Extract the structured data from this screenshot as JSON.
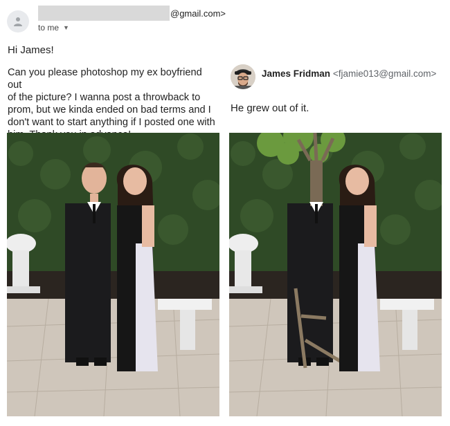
{
  "original_email": {
    "sender_suffix": "@gmail.com>",
    "recipient_label": "to me",
    "greeting": "Hi James!",
    "body": "Can you please photoshop my ex boyfriend out\nof the picture? I wanna post a throwback to\nprom, but we kinda ended on bad terms and I\ndon't want to start anything if I posted one with\nhim. Thank you in advance!"
  },
  "reply": {
    "sender_name": "James Fridman",
    "sender_email": "<fjamie013@gmail.com>",
    "message": "He grew out of it."
  },
  "icons": {
    "sender_avatar": "person-icon",
    "recipient_dropdown": "caret-down-icon"
  },
  "images": {
    "original_photo": "prom photo of couple in front of hedge",
    "edited_photo": "edited prom photo with tree trunk replacing boyfriend"
  }
}
